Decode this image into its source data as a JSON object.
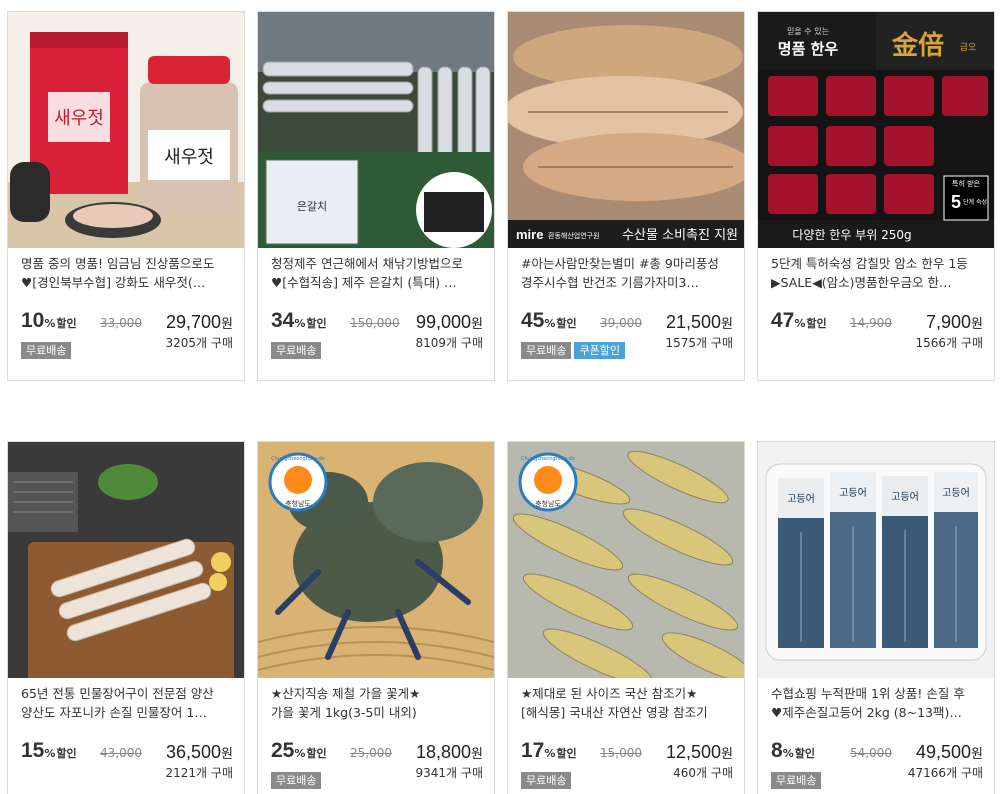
{
  "products": [
    {
      "line1": "명품 중의 명품! 임금님 진상품으로도",
      "line2": "♥[경인북부수협] 강화도 새우젓(…",
      "discount": "10",
      "pct": "%",
      "halin": "할인",
      "orig": "33,000",
      "price": "29,700",
      "won": "원",
      "badges": [
        "무료배송"
      ],
      "count": "3205개 구매",
      "img_text": [
        "새우젓",
        "새우젓"
      ]
    },
    {
      "line1": "청정제주 연근해에서 채낚기방법으로",
      "line2": "♥[수협직송] 제주 은갈치 (특대) …",
      "discount": "34",
      "pct": "%",
      "halin": "할인",
      "orig": "150,000",
      "price": "99,000",
      "won": "원",
      "badges": [
        "무료배송"
      ],
      "count": "8109개 구매",
      "img_text": [
        "은갈치"
      ]
    },
    {
      "line1": "#아는사람만찾는별미 #총 9마리풍성",
      "line2": "경주시수협 반건조 기름가자미3…",
      "discount": "45",
      "pct": "%",
      "halin": "할인",
      "orig": "39,000",
      "price": "21,500",
      "won": "원",
      "badges": [
        "무료배송",
        "쿠폰할인"
      ],
      "count": "1575개 구매",
      "img_text": [
        "mire",
        "환동해산업연구원",
        "수산물 소비촉진 지원"
      ]
    },
    {
      "line1": "5단계 특허숙성 감칠맛 암소 한우 1등",
      "line2": "▶SALE◀(암소)명품한우금오 한…",
      "discount": "47",
      "pct": "%",
      "halin": "할인",
      "orig": "14,900",
      "price": "7,900",
      "won": "원",
      "badges": [],
      "count": "1566개 구매",
      "img_text": [
        "믿을 수 있는",
        "명품 한우",
        "金倍",
        "금오",
        "다양한 한우 부위 250g",
        "특허 받은",
        "5",
        "단계 숙성"
      ]
    },
    {
      "line1": "65년 전통 민물장어구이 전문점 양산",
      "line2": "양산도 자포니카 손질 민물장어 1…",
      "discount": "15",
      "pct": "%",
      "halin": "할인",
      "orig": "43,000",
      "price": "36,500",
      "won": "원",
      "badges": [],
      "count": "2121개 구매",
      "img_text": []
    },
    {
      "line1": "★산지직송 제철 가을 꽃게★",
      "line2": "가을 꽃게 1kg(3-5미 내외)",
      "discount": "25",
      "pct": "%",
      "halin": "할인",
      "orig": "25,000",
      "price": "18,800",
      "won": "원",
      "badges": [
        "무료배송"
      ],
      "count": "9341개 구매",
      "img_text": [
        "Chungcheongnam-do",
        "충청남도"
      ]
    },
    {
      "line1": "★제대로 된 사이즈 국산 참조기★",
      "line2": "[해식몽] 국내산 자연산 영광 참조기",
      "discount": "17",
      "pct": "%",
      "halin": "할인",
      "orig": "15,000",
      "price": "12,500",
      "won": "원",
      "badges": [
        "무료배송"
      ],
      "count": "460개 구매",
      "img_text": [
        "Chungcheongnam-do",
        "충청남도"
      ]
    },
    {
      "line1": "수협쇼핑 누적판매 1위 상품! 손질 후",
      "line2": "♥제주손질고등어 2kg (8~13팩)…",
      "discount": "8",
      "pct": "%",
      "halin": "할인",
      "orig": "54,000",
      "price": "49,500",
      "won": "원",
      "badges": [
        "무료배송"
      ],
      "count": "47166개 구매",
      "img_text": [
        "고등어",
        "고등어",
        "고등어",
        "고등어"
      ]
    }
  ],
  "colors": {
    "badge_gray": "#8a8a8a",
    "badge_blue": "#4aa3d8",
    "border": "#dcdcdc"
  }
}
